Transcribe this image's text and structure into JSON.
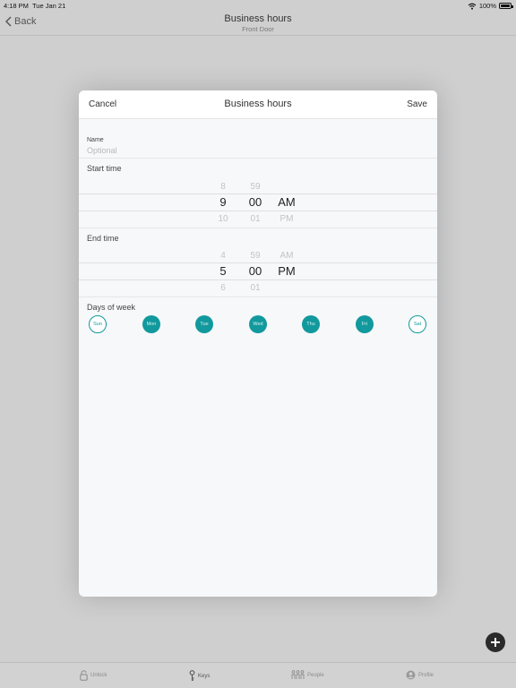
{
  "status_bar": {
    "time": "4:18 PM",
    "date": "Tue Jan 21",
    "battery": "100%"
  },
  "nav": {
    "back_label": "Back",
    "title": "Business hours",
    "subtitle": "Front Door"
  },
  "modal": {
    "cancel_label": "Cancel",
    "title": "Business hours",
    "save_label": "Save",
    "name_label": "Name",
    "name_placeholder": "Optional",
    "start_time": {
      "label": "Start time",
      "hour": {
        "above": "8",
        "selected": "9",
        "below": "10"
      },
      "minute": {
        "above": "59",
        "selected": "00",
        "below": "01"
      },
      "period": {
        "above": "",
        "selected": "AM",
        "below": "PM"
      }
    },
    "end_time": {
      "label": "End time",
      "hour": {
        "above": "4",
        "selected": "5",
        "below": "6"
      },
      "minute": {
        "above": "59",
        "selected": "00",
        "below": "01"
      },
      "period": {
        "above": "AM",
        "selected": "PM",
        "below": ""
      }
    },
    "days_label": "Days of week",
    "days": [
      {
        "label": "Sun",
        "selected": false
      },
      {
        "label": "Mon",
        "selected": true
      },
      {
        "label": "Tue",
        "selected": true
      },
      {
        "label": "Wed",
        "selected": true
      },
      {
        "label": "Thu",
        "selected": true
      },
      {
        "label": "Fri",
        "selected": true
      },
      {
        "label": "Sat",
        "selected": false
      }
    ]
  },
  "tabs": [
    {
      "label": "Unlock",
      "icon": "lock-icon"
    },
    {
      "label": "Keys",
      "icon": "key-icon"
    },
    {
      "label": "People",
      "icon": "people-icon"
    },
    {
      "label": "Profile",
      "icon": "profile-icon"
    }
  ],
  "colors": {
    "accent": "#12999d",
    "fab": "#2b2b2b"
  }
}
